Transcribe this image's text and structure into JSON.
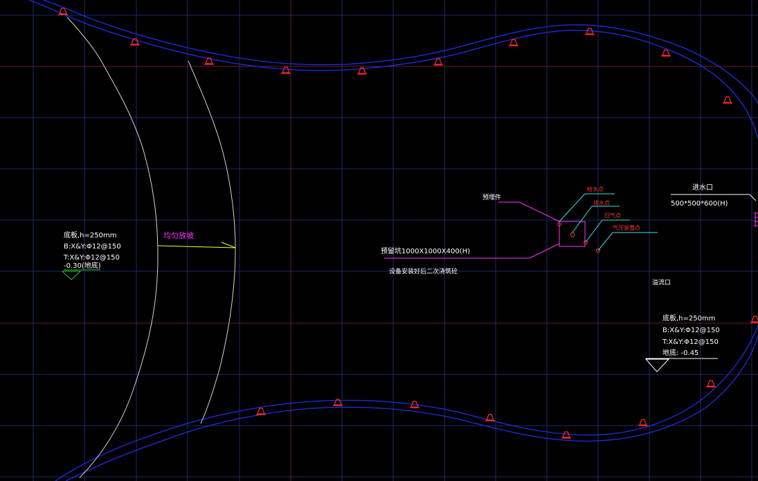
{
  "colors": {
    "background": "#000000",
    "grid_blue": "#1c2a6e",
    "grid_red": "#6a1a2a",
    "wall_blue": "#1f2ee6",
    "marker_red": "#ff2a2a",
    "curve_white": "#d6d6c8",
    "text_white": "#ffffff",
    "magenta": "#ff33ff",
    "cyan": "#33e6e6",
    "red_text": "#ff3333",
    "yellow": "#ffff33",
    "green": "#33cc33"
  },
  "notes": {
    "left_slab": {
      "line1": "底板,h=250mm",
      "line2": "B:X&Y:Φ12@150",
      "line3": "T:X&Y:Φ12@150",
      "line4": "-0.30(地底)"
    },
    "slope_label": "均匀放坡",
    "embedded_part": "预埋件",
    "reserved_pit": "预留坑1000X1000X400(H)",
    "pit_note": "设备安装好后二次浇筑砼",
    "inlet_title": "进水口",
    "inlet_size": "500*500*600(H)",
    "overflow": "溢流口",
    "right_slab": {
      "line1": "底板,h=250mm",
      "line2": "B:X&Y:Φ12@150",
      "line3": "T:X&Y:Φ12@150",
      "line4": "地底: -0.45"
    }
  },
  "callouts": {
    "item1": "给水点",
    "item2": "排水点",
    "item3": "回气点",
    "item4": "气压装置点"
  }
}
